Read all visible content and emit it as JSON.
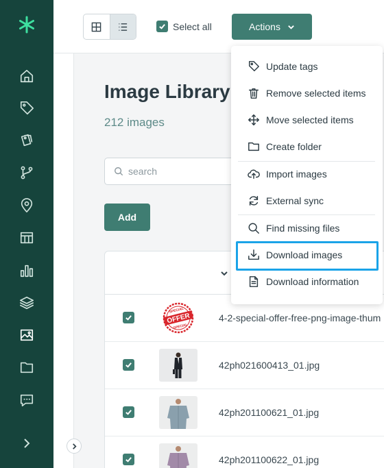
{
  "sidebar": {
    "logo": "asterisk-logo",
    "items": [
      {
        "name": "home-icon"
      },
      {
        "name": "tag-icon"
      },
      {
        "name": "tags-icon"
      },
      {
        "name": "branch-icon"
      },
      {
        "name": "location-pin-icon"
      },
      {
        "name": "board-icon"
      },
      {
        "name": "bar-chart-icon"
      },
      {
        "name": "layers-icon",
        "active": false
      },
      {
        "name": "image-icon",
        "active": true
      },
      {
        "name": "folder-icon"
      },
      {
        "name": "chat-icon"
      }
    ],
    "expand_icon": "chevron-right-icon"
  },
  "toolbar": {
    "grid_view_icon": "grid-icon",
    "list_view_icon": "list-icon",
    "select_all_label": "Select all",
    "select_all_checked": true,
    "actions_label": "Actions"
  },
  "page": {
    "title": "Image Library",
    "count": "212 images",
    "search_placeholder": "search",
    "add_label": "Add"
  },
  "table": {
    "rows": [
      {
        "checked": true,
        "filename": "4-2-special-offer-free-png-image-thum",
        "thumb": "special-offer-stamp"
      },
      {
        "checked": true,
        "filename": "42ph021600413_01.jpg",
        "thumb": "suit-person"
      },
      {
        "checked": true,
        "filename": "42ph201100621_01.jpg",
        "thumb": "shirt-grey"
      },
      {
        "checked": true,
        "filename": "42ph201100622_01.jpg",
        "thumb": "shirt-purple"
      }
    ],
    "stamp_text": "OFFER",
    "stamp_top": "SPECIAL",
    "stamp_bottom": "SPECIAL"
  },
  "actions_menu": {
    "items": [
      {
        "label": "Update tags",
        "icon": "tag-icon"
      },
      {
        "label": "Remove selected items",
        "icon": "trash-icon"
      },
      {
        "label": "Move selected items",
        "icon": "move-icon"
      },
      {
        "label": "Create folder",
        "icon": "folder-icon"
      },
      {
        "label": "Import images",
        "icon": "cloud-upload-icon"
      },
      {
        "label": "External sync",
        "icon": "sync-icon"
      },
      {
        "label": "Find missing files",
        "icon": "search-icon"
      },
      {
        "label": "Download images",
        "icon": "download-icon",
        "highlighted": true
      },
      {
        "label": "Download information",
        "icon": "document-icon"
      }
    ]
  },
  "colors": {
    "sidebar_bg": "#16443c",
    "accent": "#3f7d72",
    "highlight": "#1aa3e8",
    "count_text": "#5d8a88"
  }
}
